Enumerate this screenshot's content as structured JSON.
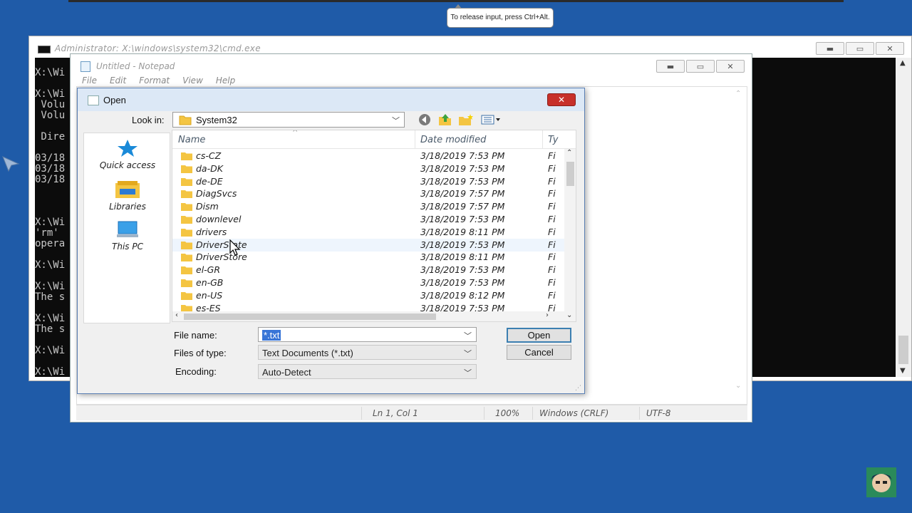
{
  "vm": {
    "tooltip": "To release input, press Ctrl+Alt."
  },
  "cmd": {
    "title": "Administrator: X:\\windows\\system32\\cmd.exe",
    "lines": [
      "X:\\Wi",
      "",
      "X:\\Wi",
      " Volu",
      " Volu",
      "",
      " Dire",
      "",
      "03/18",
      "03/18",
      "03/18",
      "",
      "",
      "",
      "X:\\Wi",
      "'rm'",
      "opera",
      "",
      "X:\\Wi",
      "",
      "X:\\Wi",
      "The s",
      "",
      "X:\\Wi",
      "The s",
      "",
      "X:\\Wi",
      "",
      "X:\\Wi"
    ]
  },
  "notepad": {
    "title": "Untitled - Notepad",
    "menu": [
      "File",
      "Edit",
      "Format",
      "View",
      "Help"
    ],
    "status": {
      "position": "Ln 1, Col 1",
      "zoom": "100%",
      "line_ending": "Windows (CRLF)",
      "encoding": "UTF-8"
    }
  },
  "dialog": {
    "title": "Open",
    "close_glyph": "✕",
    "look_in_label": "Look in:",
    "look_in_value": "System32",
    "places": [
      {
        "label": "Quick access",
        "icon": "star-icon"
      },
      {
        "label": "Libraries",
        "icon": "libraries-icon"
      },
      {
        "label": "This PC",
        "icon": "computer-icon"
      }
    ],
    "columns": {
      "name": "Name",
      "date": "Date modified",
      "type": "Ty"
    },
    "files": [
      {
        "name": "cs-CZ",
        "date": "3/18/2019 7:53 PM",
        "type": "Fi"
      },
      {
        "name": "da-DK",
        "date": "3/18/2019 7:53 PM",
        "type": "Fi"
      },
      {
        "name": "de-DE",
        "date": "3/18/2019 7:53 PM",
        "type": "Fi"
      },
      {
        "name": "DiagSvcs",
        "date": "3/18/2019 7:57 PM",
        "type": "Fi"
      },
      {
        "name": "Dism",
        "date": "3/18/2019 7:57 PM",
        "type": "Fi"
      },
      {
        "name": "downlevel",
        "date": "3/18/2019 7:53 PM",
        "type": "Fi"
      },
      {
        "name": "drivers",
        "date": "3/18/2019 8:11 PM",
        "type": "Fi"
      },
      {
        "name": "DriverState",
        "date": "3/18/2019 7:53 PM",
        "type": "Fi"
      },
      {
        "name": "DriverStore",
        "date": "3/18/2019 8:11 PM",
        "type": "Fi"
      },
      {
        "name": "el-GR",
        "date": "3/18/2019 7:53 PM",
        "type": "Fi"
      },
      {
        "name": "en-GB",
        "date": "3/18/2019 7:53 PM",
        "type": "Fi"
      },
      {
        "name": "en-US",
        "date": "3/18/2019 8:12 PM",
        "type": "Fi"
      },
      {
        "name": "es-ES",
        "date": "3/18/2019 7:53 PM",
        "type": "Fi"
      }
    ],
    "hovered_file": "DriverState",
    "file_name_label": "File name:",
    "file_name_value": "*.txt",
    "file_type_label": "Files of type:",
    "file_type_value": "Text Documents (*.txt)",
    "encoding_label": "Encoding:",
    "encoding_value": "Auto-Detect",
    "open_button": "Open",
    "cancel_button": "Cancel"
  },
  "colors": {
    "desktop": "#1f5ba8",
    "close_red": "#c7302a",
    "selection": "#3875d7",
    "folder": "#f4c542"
  }
}
